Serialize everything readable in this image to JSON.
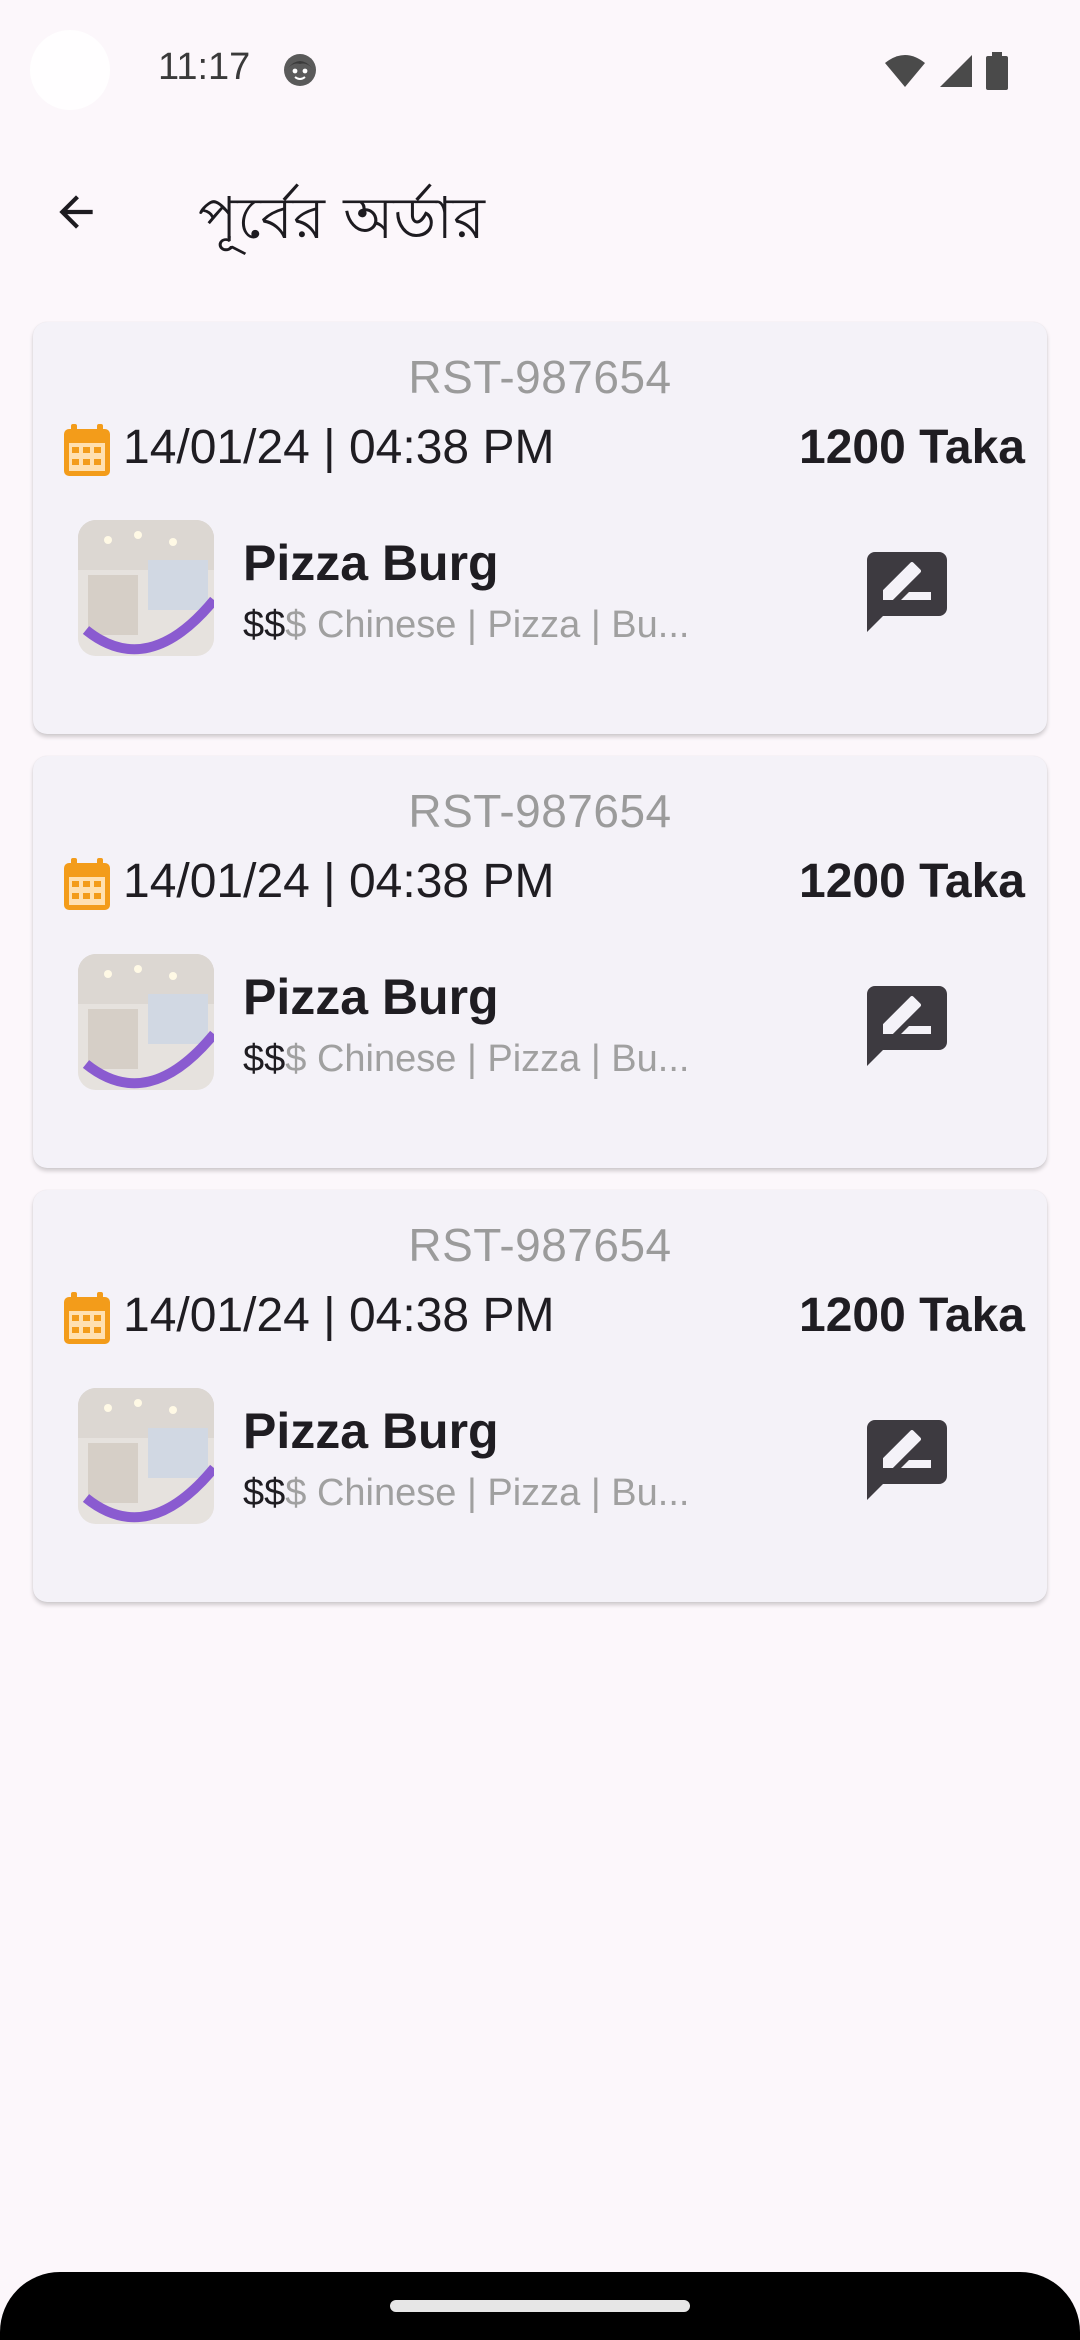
{
  "status_bar": {
    "time": "11:17",
    "icons": [
      "face-icon",
      "wifi-icon",
      "signal-icon",
      "battery-icon"
    ]
  },
  "app_bar": {
    "title": "পূর্বের অর্ডার",
    "back_icon": "arrow-back-icon"
  },
  "orders": [
    {
      "order_id": "RST-987654",
      "datetime": "14/01/24 | 04:38 PM",
      "total": "1200 Taka",
      "restaurant_name": "Pizza Burg",
      "price_level_active": "$$",
      "price_level_inactive": "$",
      "cuisines": " Chinese | Pizza | Bu...",
      "review_icon": "rate-review-icon"
    },
    {
      "order_id": "RST-987654",
      "datetime": "14/01/24 | 04:38 PM",
      "total": "1200 Taka",
      "restaurant_name": "Pizza Burg",
      "price_level_active": "$$",
      "price_level_inactive": "$",
      "cuisines": " Chinese | Pizza | Bu...",
      "review_icon": "rate-review-icon"
    },
    {
      "order_id": "RST-987654",
      "datetime": "14/01/24 | 04:38 PM",
      "total": "1200 Taka",
      "restaurant_name": "Pizza Burg",
      "price_level_active": "$$",
      "price_level_inactive": "$",
      "cuisines": " Chinese | Pizza | Bu...",
      "review_icon": "rate-review-icon"
    }
  ],
  "colors": {
    "background": "#fcf7fb",
    "card": "#f4f2f8",
    "calendar_accent": "#f39c1a",
    "muted_text": "#9b9b9b",
    "icon_dark": "#3d3a40"
  }
}
